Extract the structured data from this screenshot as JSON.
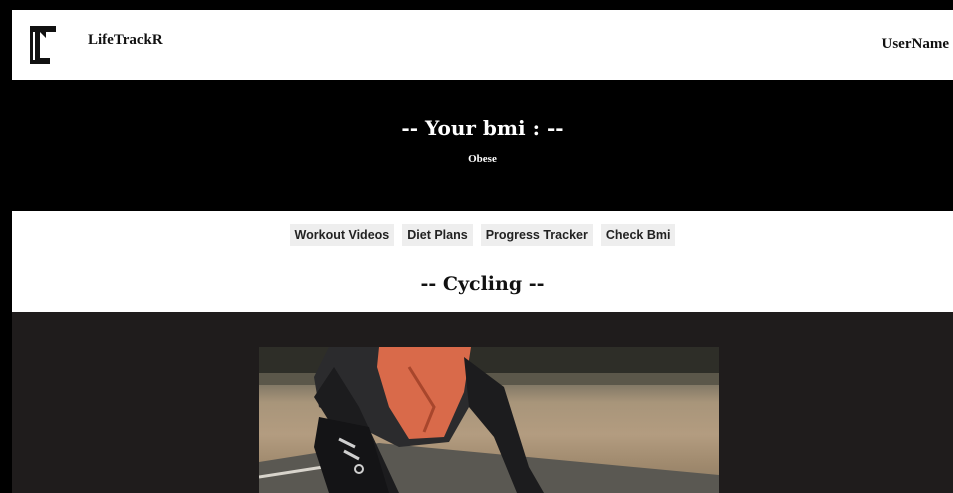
{
  "header": {
    "brand": "LifeTrackR",
    "username": "UserName",
    "logo_icon": "lt-logo-icon"
  },
  "hero": {
    "title": "-- Your bmi : --",
    "status": "Obese"
  },
  "nav": {
    "items": [
      "Workout Videos",
      "Diet Plans",
      "Progress Tracker",
      "Check Bmi"
    ]
  },
  "section": {
    "title": "-- Cycling --"
  },
  "colors": {
    "hero_bg": "#000000",
    "content_bg": "#1f1c1c",
    "nav_button_bg": "#eeeeee",
    "jersey": "#d96a4a"
  }
}
